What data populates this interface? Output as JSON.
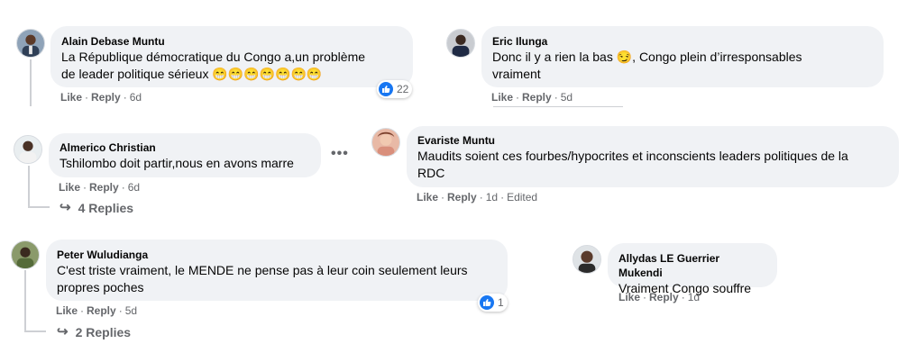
{
  "colors": {
    "bubble": "#f0f2f5",
    "meta": "#65676b",
    "like_blue": "#1877f2"
  },
  "comments": [
    {
      "author": "Alain Debase Muntu",
      "text_line1": "La République démocratique du Congo a,un problème",
      "text_line2": "de leader politique sérieux 😁😁😁😁😁😁😁",
      "like": "Like",
      "reply": "Reply",
      "time": "6d",
      "reaction_icon": "like-icon",
      "reaction_count": "22"
    },
    {
      "author": "Eric Ilunga",
      "text_line1": "Donc il y a rien la bas 😏, Congo plein d’irresponsables",
      "text_line2": "vraiment",
      "like": "Like",
      "reply": "Reply",
      "time": "5d"
    },
    {
      "author": "Almerico Christian",
      "text_line1": "Tshilombo doit partir,nous en avons marre",
      "like": "Like",
      "reply": "Reply",
      "time": "6d",
      "replies": "4 Replies",
      "more_icon": "ellipsis-icon"
    },
    {
      "author": "Evariste Muntu",
      "text_line1": "Maudits soient ces fourbes/hypocrites et inconscients leaders politiques de la",
      "text_line2": "RDC",
      "like": "Like",
      "reply": "Reply",
      "time": "1d",
      "edited": "Edited"
    },
    {
      "author": "Peter Wuludianga",
      "text_line1": "C'est triste vraiment, le MENDE ne pense pas à leur coin seulement leurs",
      "text_line2": "propres poches",
      "like": "Like",
      "reply": "Reply",
      "time": "5d",
      "reaction_icon": "like-icon",
      "reaction_count": "1",
      "replies": "2 Replies"
    },
    {
      "author": "Allydas LE Guerrier Mukendi",
      "text_line1": "Vraiment Congo souffre",
      "like": "Like",
      "reply": "Reply",
      "time": "1d"
    }
  ]
}
